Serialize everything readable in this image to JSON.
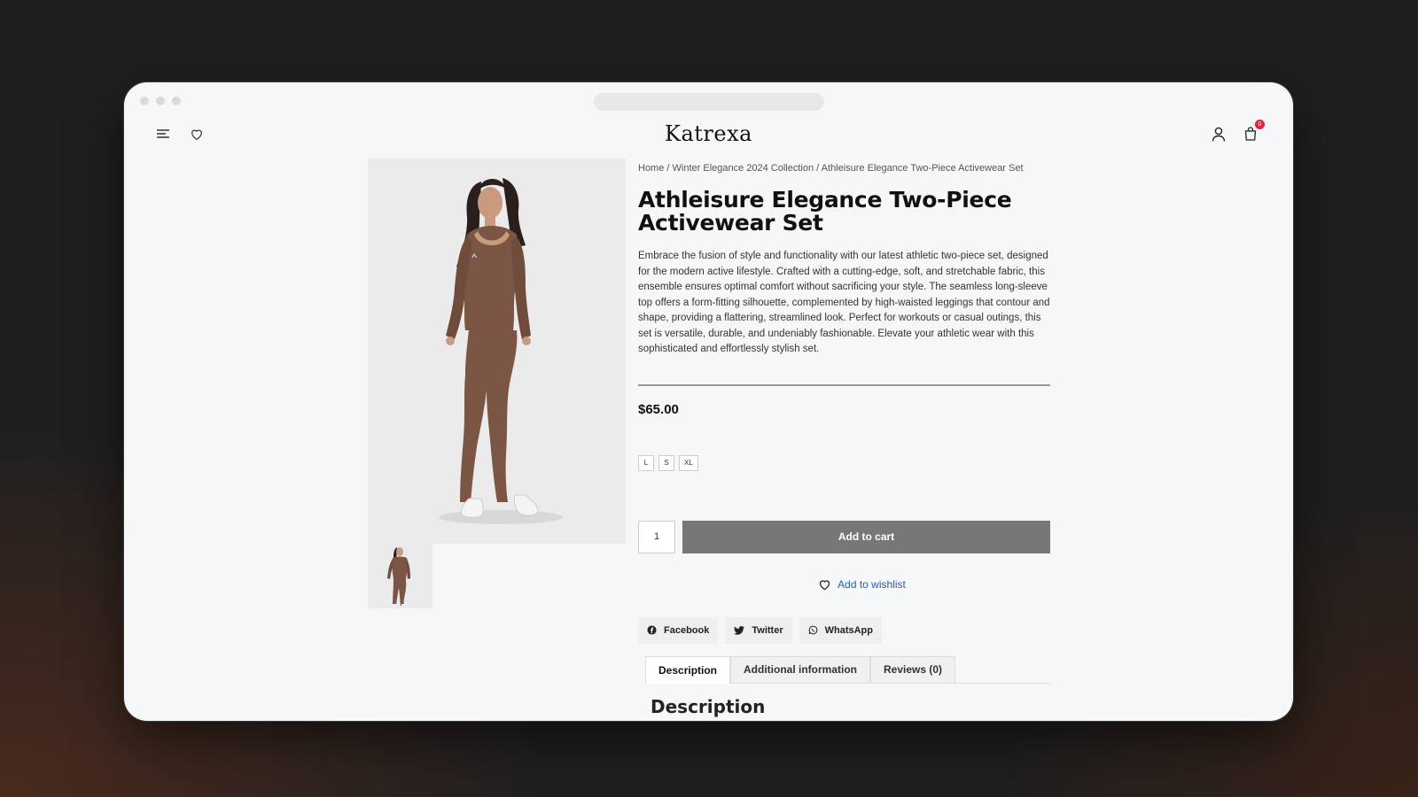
{
  "header": {
    "brand": "Katrexa",
    "cart_count": "0"
  },
  "breadcrumb": {
    "home": "Home",
    "collection": "Winter Elegance 2024 Collection",
    "current": "Athleisure Elegance Two-Piece Activewear Set",
    "separator": " / "
  },
  "product": {
    "title": "Athleisure Elegance Two-Piece Activewear Set",
    "description": "Embrace the fusion of style and functionality with our latest athletic two-piece set, designed for the modern active lifestyle. Crafted with a cutting-edge, soft, and stretchable fabric, this ensemble ensures optimal comfort without sacrificing your style. The seamless long-sleeve top offers a form-fitting silhouette, complemented by high-waisted leggings that contour and shape, providing a flattering, streamlined look. Perfect for workouts or casual outings, this set is versatile, durable, and undeniably fashionable. Elevate your athletic wear with this sophisticated and effortlessly stylish set.",
    "price": "$65.00",
    "sizes": [
      "L",
      "S",
      "XL"
    ],
    "quantity": "1",
    "add_to_cart": "Add to cart",
    "add_to_wishlist": "Add to wishlist"
  },
  "share": {
    "facebook": "Facebook",
    "twitter": "Twitter",
    "whatsapp": "WhatsApp"
  },
  "tabs": {
    "description": "Description",
    "additional": "Additional information",
    "reviews": "Reviews (0)"
  },
  "section_heading": "Description",
  "colors": {
    "accent_link": "#2a5db0",
    "button": "#777777",
    "badge": "#e0243c",
    "garment": "#7b5645"
  }
}
